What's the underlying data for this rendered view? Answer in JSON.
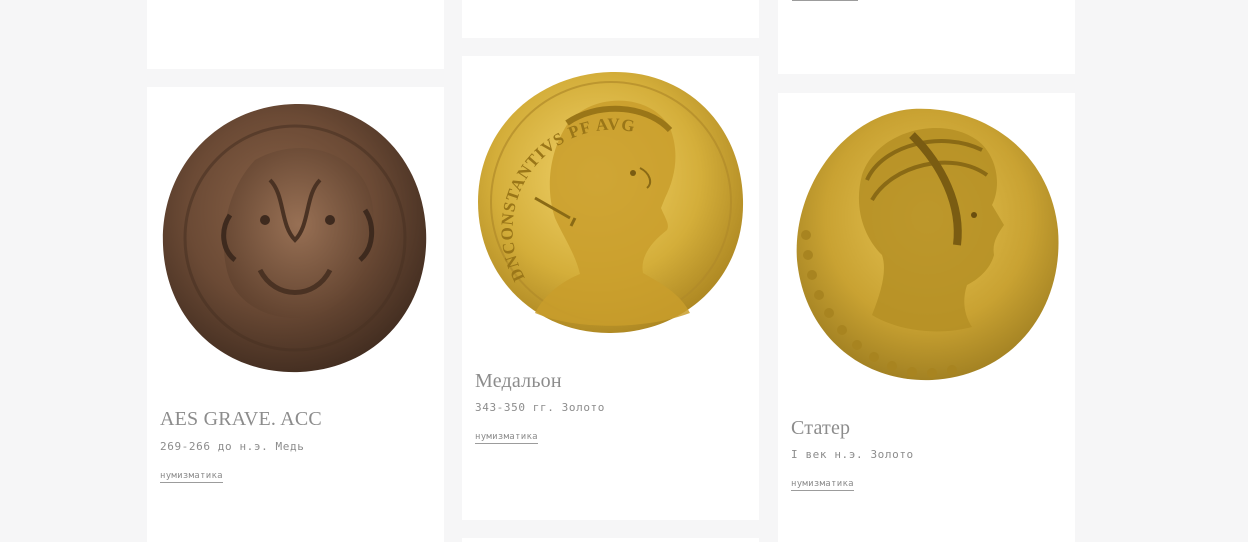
{
  "cards": [
    {
      "title": "AES GRAVE. ACC",
      "meta": "269-266 до н.э. Медь",
      "tag": "нумизматика",
      "image": "bronze-janus-coin"
    },
    {
      "title": "Медальон",
      "meta": "343-350 гг. Золото",
      "tag": "нумизматика",
      "image": "gold-emperor-medallion",
      "legend": "DNCONSTANTIVS PF AVG"
    },
    {
      "title": "Статер",
      "meta": "I век н.э. Золото",
      "tag": "нумизматика",
      "image": "gold-stater-coin"
    }
  ],
  "colors": {
    "page_background": "#f6f6f7",
    "card_background": "#ffffff",
    "text_gray": "#8c8c8c",
    "bronze": "#6b4a35",
    "gold": "#d4ae3a"
  }
}
